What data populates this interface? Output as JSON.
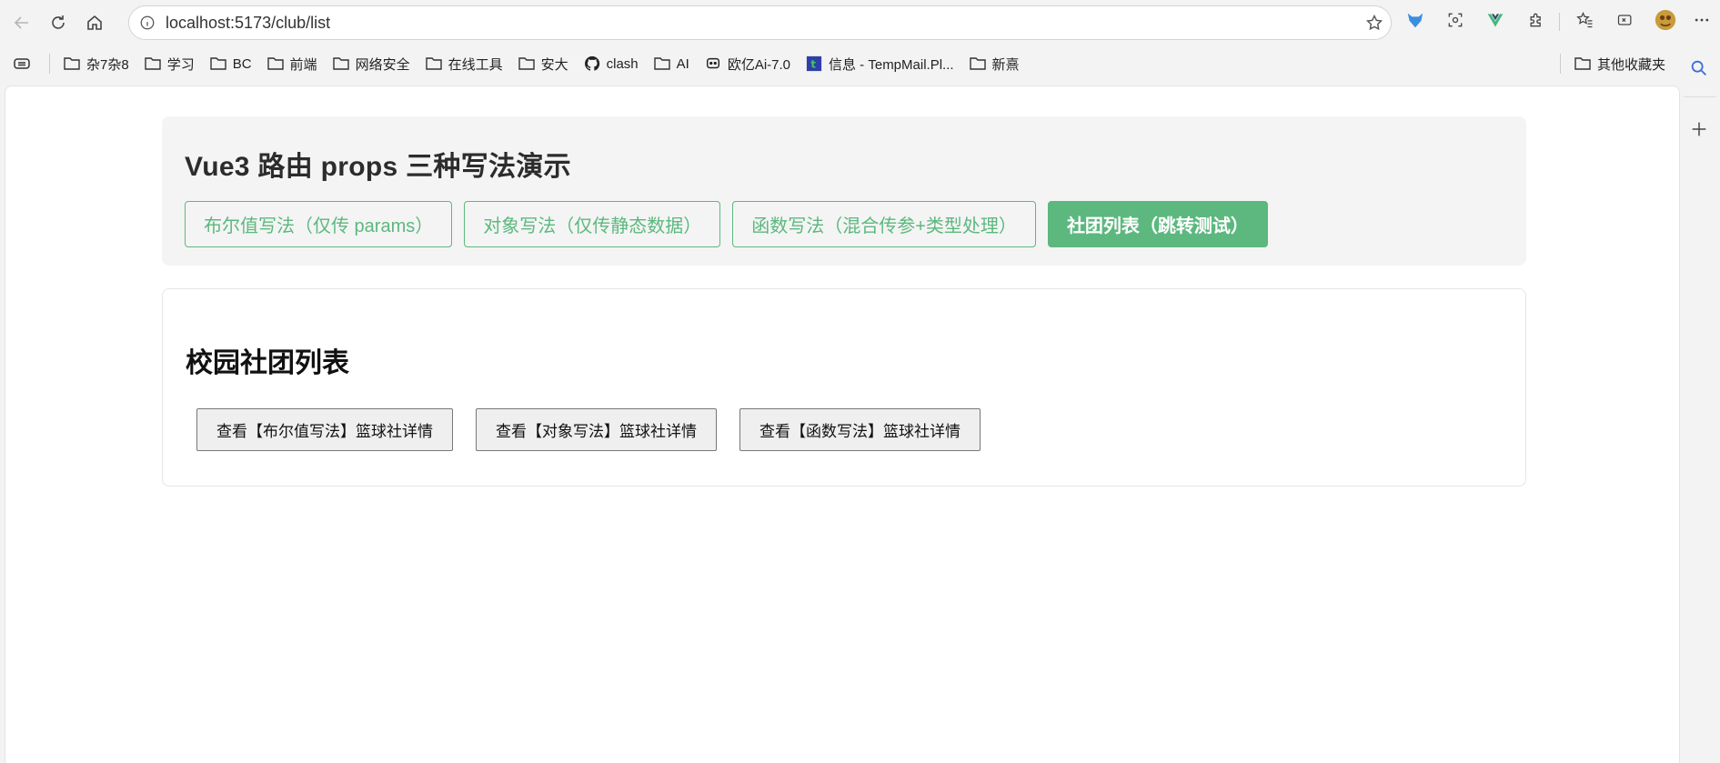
{
  "browser": {
    "url": "localhost:5173/club/list",
    "bookmarks": [
      {
        "label": "杂7杂8",
        "icon": "folder-icon"
      },
      {
        "label": "学习",
        "icon": "folder-icon"
      },
      {
        "label": "BC",
        "icon": "folder-icon"
      },
      {
        "label": "前端",
        "icon": "folder-icon"
      },
      {
        "label": "网络安全",
        "icon": "folder-icon"
      },
      {
        "label": "在线工具",
        "icon": "folder-icon"
      },
      {
        "label": "安大",
        "icon": "folder-icon"
      },
      {
        "label": "clash",
        "icon": "github-icon"
      },
      {
        "label": "AI",
        "icon": "folder-icon"
      },
      {
        "label": "欧亿Ai-7.0",
        "icon": "chat-bot-icon"
      },
      {
        "label": "信息 - TempMail.Pl...",
        "icon": "tempmail-icon"
      },
      {
        "label": "新熹",
        "icon": "folder-icon"
      }
    ],
    "other_bookmarks": "其他收藏夹"
  },
  "page": {
    "nav_title": "Vue3 路由 props 三种写法演示",
    "nav_buttons": [
      {
        "label": "布尔值写法（仅传 params）",
        "active": false
      },
      {
        "label": "对象写法（仅传静态数据）",
        "active": false
      },
      {
        "label": "函数写法（混合传参+类型处理）",
        "active": false
      },
      {
        "label": "社团列表（跳转测试）",
        "active": true
      }
    ],
    "list_title": "校园社团列表",
    "list_buttons": [
      "查看【布尔值写法】篮球社详情",
      "查看【对象写法】篮球社详情",
      "查看【函数写法】篮球社详情"
    ]
  },
  "colors": {
    "accent_green": "#5cb87e",
    "nav_card_bg": "#f4f4f4"
  }
}
